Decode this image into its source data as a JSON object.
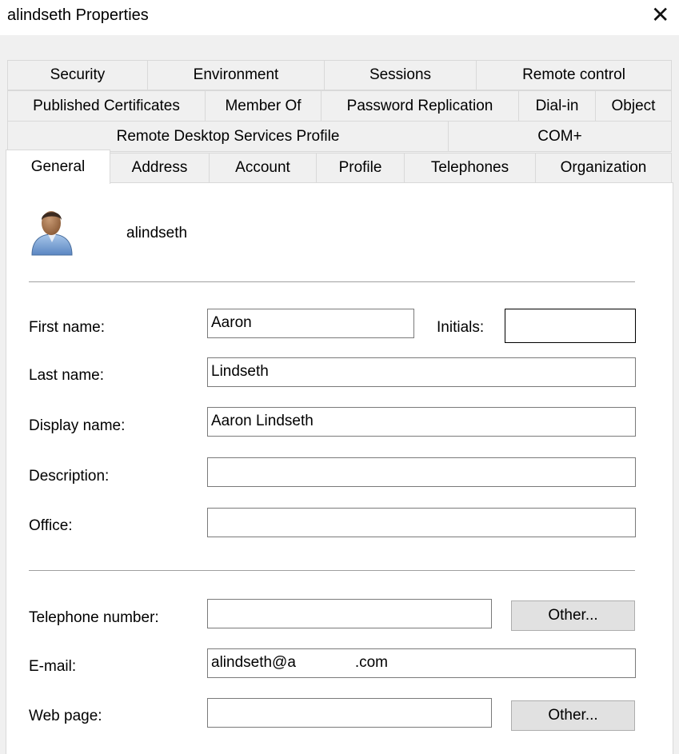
{
  "window": {
    "title": "alindseth Properties",
    "close_glyph": "✕"
  },
  "tabs": {
    "row1": [
      "Security",
      "Environment",
      "Sessions",
      "Remote control"
    ],
    "row2": [
      "Published Certificates",
      "Member Of",
      "Password Replication",
      "Dial-in",
      "Object"
    ],
    "row3": [
      "Remote Desktop Services Profile",
      "COM+"
    ],
    "row4": [
      "General",
      "Address",
      "Account",
      "Profile",
      "Telephones",
      "Organization"
    ],
    "active": "General"
  },
  "general": {
    "account_name": "alindseth",
    "avatar_icon": "user-icon",
    "fields": {
      "first_name": {
        "label": "First name:",
        "value": "Aaron"
      },
      "initials": {
        "label": "Initials:",
        "value": ""
      },
      "last_name": {
        "label": "Last name:",
        "value": "Lindseth"
      },
      "display_name": {
        "label": "Display name:",
        "value": "Aaron Lindseth"
      },
      "description": {
        "label": "Description:",
        "value": ""
      },
      "office": {
        "label": "Office:",
        "value": ""
      },
      "telephone": {
        "label": "Telephone number:",
        "value": ""
      },
      "email": {
        "label": "E-mail:",
        "value": "alindseth@a              .com"
      },
      "web_page": {
        "label": "Web page:",
        "value": ""
      }
    },
    "other_button_label": "Other..."
  }
}
